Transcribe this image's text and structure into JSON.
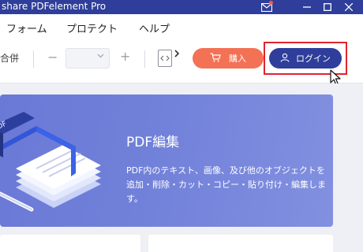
{
  "window": {
    "title": "share PDFelement Pro"
  },
  "menu": {
    "items": [
      "フォーム",
      "プロテクト",
      "ヘルプ"
    ]
  },
  "toolbar": {
    "merge_label": "合併",
    "zoom_minus": "−",
    "zoom_plus": "+",
    "buy_label": "購入",
    "login_label": "ログイン"
  },
  "banner": {
    "title": "PDF編集",
    "desc_line1": "PDF内のテキスト、画像、及び他のオブジェクトを",
    "desc_line2": "追加・削除・カット・コピー・貼り付け・編集しま",
    "desc_line3": "す。"
  },
  "colors": {
    "titlebar": "#2f3e9a",
    "buy_button": "#f37155",
    "login_button": "#2f3e9a",
    "highlight": "#e0242e",
    "banner": "#7181d9"
  },
  "icons": {
    "mail": "mail-icon",
    "minimize": "minimize-icon",
    "maximize": "maximize-icon",
    "close": "close-icon",
    "cart": "cart-icon",
    "user": "user-icon",
    "fit_page": "fit-page-icon",
    "more": "chevron-right-icon"
  }
}
